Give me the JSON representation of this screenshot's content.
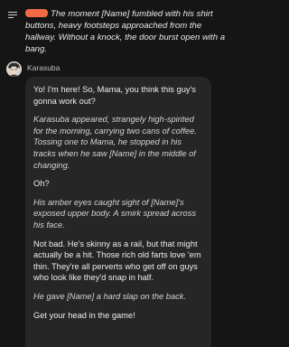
{
  "user_message": {
    "text": "The moment [Name] fumbled with his shirt buttons, heavy footsteps approached from the hallway. Without a knock, the door burst open with a bang."
  },
  "bot": {
    "name": "Karasuba",
    "paragraphs": [
      {
        "style": "normal",
        "text": "Yo! I'm here! So, Mama, you think this guy's gonna work out?"
      },
      {
        "style": "italic",
        "text": "Karasuba appeared, strangely high-spirited for the morning, carrying two cans of coffee. Tossing one to Mama, he stopped in his tracks when he saw [Name] in the middle of changing."
      },
      {
        "style": "normal",
        "text": "Oh?"
      },
      {
        "style": "italic",
        "text": "His amber eyes caught sight of [Name]'s exposed upper body. A smirk spread across his face."
      },
      {
        "style": "normal",
        "text": "Not bad. He's skinny as a rail, but that might actually be a hit. Those rich old farts love 'em thin. They're all perverts who get off on guys who look like they'd snap in half."
      },
      {
        "style": "italic",
        "text": "He gave [Name] a hard slap on the back."
      },
      {
        "style": "normal",
        "text": "Get your head in the game!"
      }
    ]
  },
  "icons": {
    "menu": "menu-lines-icon",
    "avatar": "character-avatar"
  },
  "colors": {
    "background": "#151515",
    "bubble": "#262626",
    "redaction": "#f26b45"
  }
}
